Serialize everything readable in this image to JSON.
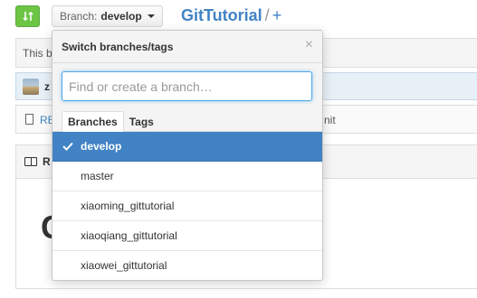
{
  "header": {
    "branch_prefix": "Branch:",
    "current_branch": "develop",
    "repo_name": "GitTutorial",
    "path_separator": "/",
    "add_symbol": "+"
  },
  "background": {
    "notice_text": "This b",
    "commit_author": "z",
    "file_name": "RE",
    "file_commit_fragment": "nit",
    "readme_title": "R",
    "readme_heading": "G"
  },
  "dropdown": {
    "title": "Switch branches/tags",
    "close_symbol": "×",
    "filter_placeholder": "Find or create a branch…",
    "tabs": [
      {
        "label": "Branches",
        "active": true
      },
      {
        "label": "Tags",
        "active": false
      }
    ],
    "branches": [
      {
        "name": "develop",
        "selected": true
      },
      {
        "name": "master",
        "selected": false
      },
      {
        "name": "xiaoming_gittutorial",
        "selected": false
      },
      {
        "name": "xiaoqiang_gittutorial",
        "selected": false
      },
      {
        "name": "xiaowei_gittutorial",
        "selected": false
      }
    ]
  },
  "colors": {
    "accent_blue": "#4183c4",
    "compare_green": "#6cc644",
    "focus_border": "#51a7e8"
  }
}
